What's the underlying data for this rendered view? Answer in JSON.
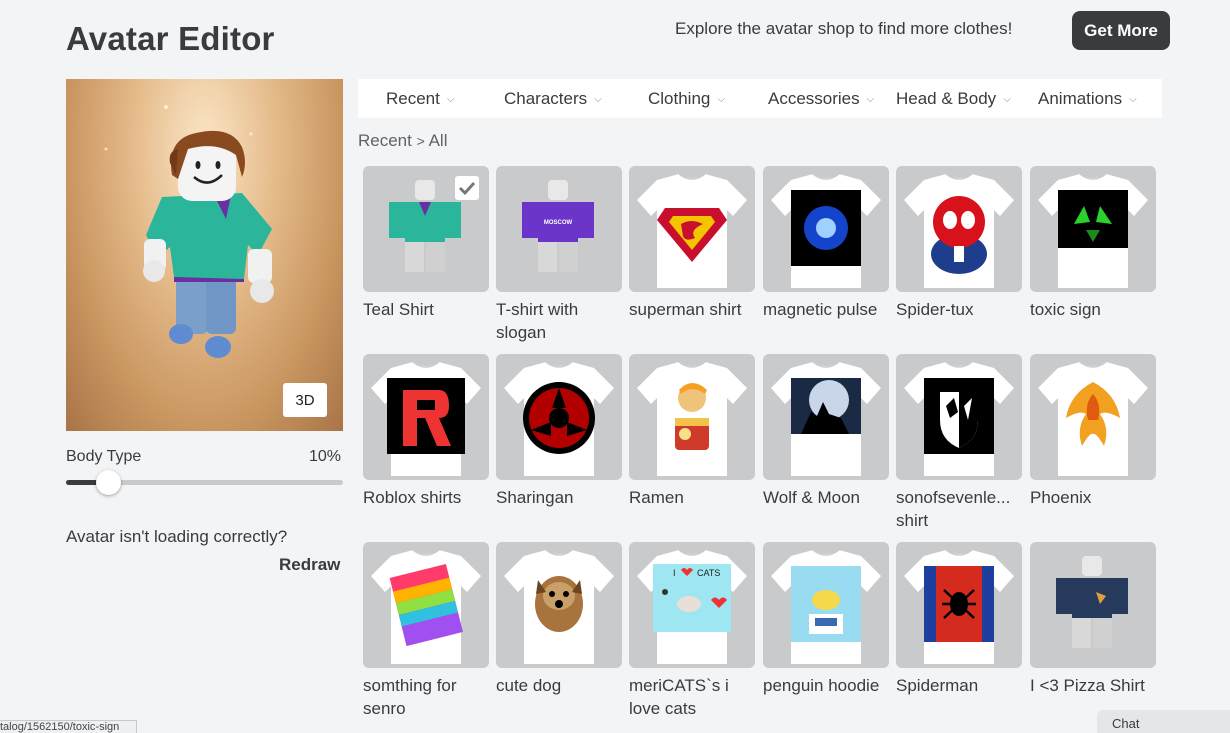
{
  "header": {
    "title": "Avatar Editor",
    "promo": "Explore the avatar shop to find more clothes!",
    "get_more": "Get More"
  },
  "preview": {
    "view_toggle": "3D",
    "body_type_label": "Body Type",
    "body_type_value": "10%",
    "body_type_fraction": 0.1,
    "loading_text": "Avatar isn't loading correctly?",
    "redraw": "Redraw"
  },
  "tabs": [
    {
      "label": "Recent"
    },
    {
      "label": "Characters"
    },
    {
      "label": "Clothing"
    },
    {
      "label": "Accessories"
    },
    {
      "label": "Head & Body"
    },
    {
      "label": "Animations"
    }
  ],
  "breadcrumb": {
    "parent": "Recent",
    "separator": ">",
    "current": "All"
  },
  "items": [
    {
      "name": "Teal Shirt",
      "selected": true,
      "art": "roblox-teal"
    },
    {
      "name": "T-shirt with slogan",
      "selected": false,
      "art": "roblox-purple"
    },
    {
      "name": "superman shirt",
      "selected": false,
      "art": "superman"
    },
    {
      "name": "magnetic pulse",
      "selected": false,
      "art": "pulse"
    },
    {
      "name": "Spider-tux",
      "selected": false,
      "art": "spider-tux"
    },
    {
      "name": "toxic sign",
      "selected": false,
      "art": "toxic"
    },
    {
      "name": "Roblox shirts",
      "selected": false,
      "art": "roblox-r"
    },
    {
      "name": "Sharingan",
      "selected": false,
      "art": "sharingan"
    },
    {
      "name": "Ramen",
      "selected": false,
      "art": "ramen"
    },
    {
      "name": "Wolf & Moon",
      "selected": false,
      "art": "wolf"
    },
    {
      "name": "sonofsevenle... shirt",
      "selected": false,
      "art": "shield"
    },
    {
      "name": "Phoenix",
      "selected": false,
      "art": "phoenix"
    },
    {
      "name": "somthing for senro",
      "selected": false,
      "art": "rainbow"
    },
    {
      "name": "cute dog",
      "selected": false,
      "art": "dog"
    },
    {
      "name": "meriCATS`s i love cats",
      "selected": false,
      "art": "cats"
    },
    {
      "name": "penguin hoodie",
      "selected": false,
      "art": "penguin"
    },
    {
      "name": "Spiderman",
      "selected": false,
      "art": "spiderman"
    },
    {
      "name": "I <3 Pizza Shirt",
      "selected": false,
      "art": "roblox-navy"
    }
  ],
  "roblox_art_labels": {
    "purple": "MOSCOW"
  },
  "cats_art_labels": {
    "i": "I",
    "cats": "CATS"
  },
  "statusbar": "talog/1562150/toxic-sign",
  "chat": "Chat",
  "colors": {
    "accent_dark": "#393b3d",
    "tile_bg": "#c8cacc",
    "page_bg": "#f2f4f5"
  }
}
